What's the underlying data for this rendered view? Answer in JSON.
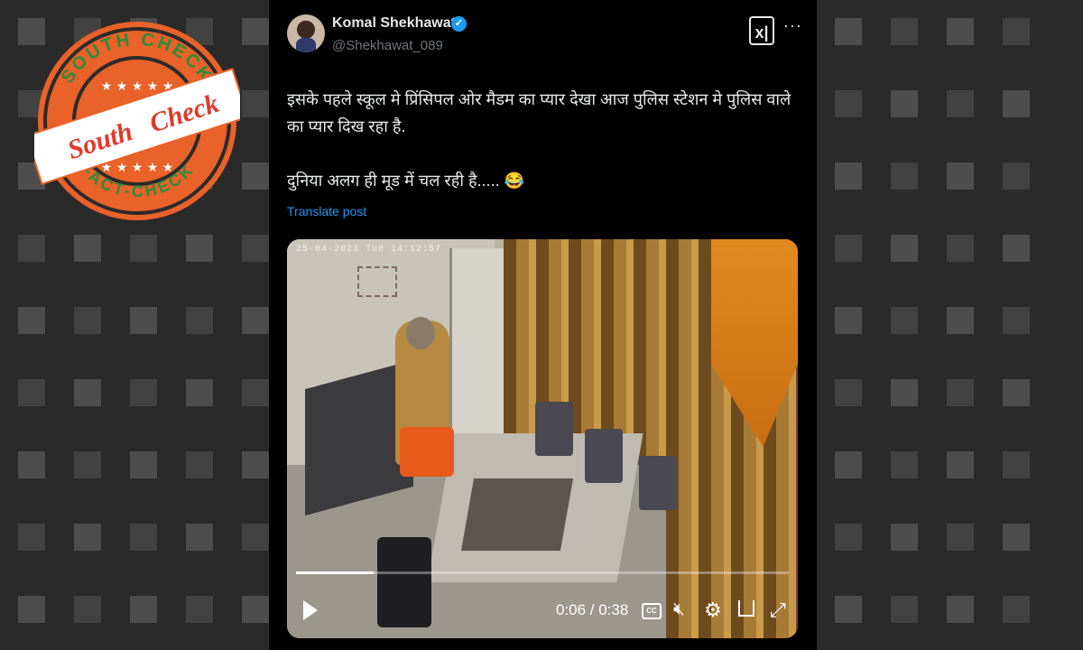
{
  "post": {
    "author_name": "Komal Shekhawat",
    "author_handle": "@Shekhawat_089",
    "text_line1": "इसके पहले स्कूल मे प्रिंसिपल ओर मैडम का प्यार देखा आज पुलिस स्टेशन मे पुलिस वाले का प्यार दिख रहा है.",
    "text_line2": "दुनिया अलग ही मूड में चल रही है..... 😂",
    "translate_label": "Translate post",
    "more_label": "···",
    "xai_label": "x|"
  },
  "video": {
    "osd_text": "25-04-2023 Tue 14:12:57",
    "time_display": "0:06 / 0:38",
    "cc_label": "CC",
    "progress_fraction": 0.158
  },
  "stamp": {
    "top_text": "SOUTH CHECK",
    "bottom_text": "FACT-CHECK",
    "center_text_1": "South",
    "center_text_2": "Check",
    "colors": {
      "ring": "#e8622a",
      "band": "#ffffff",
      "green": "#2e8b3a",
      "text_red": "#e03a2a"
    }
  },
  "colors": {
    "background": "#2b2b2b",
    "post_bg": "#000000",
    "link": "#1d9bf0",
    "text": "#e7e9ea",
    "muted": "#71767b"
  }
}
